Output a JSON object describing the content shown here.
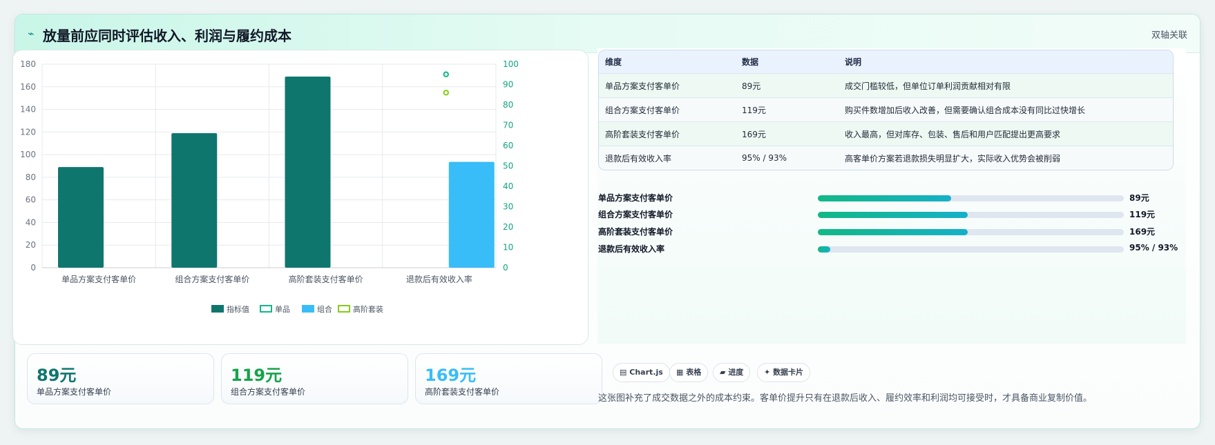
{
  "header": {
    "icon": "pulse-icon",
    "title": "放量前应同时评估收入、利润与履约成本",
    "badge": "双轴关联"
  },
  "chart_data": {
    "type": "bar",
    "categories": [
      "单品方案支付客单价",
      "组合方案支付客单价",
      "高阶套装支付客单价",
      "退款后有效收入率"
    ],
    "series": [
      {
        "name": "指标值",
        "type": "bar",
        "axis": "left",
        "values": [
          89,
          119,
          169,
          null
        ],
        "color": "#0f766e"
      },
      {
        "name": "单品",
        "type": "point",
        "axis": "right",
        "values": [
          null,
          null,
          null,
          95
        ],
        "color": "#12b886"
      },
      {
        "name": "组合",
        "type": "bar",
        "axis": "right",
        "values": [
          null,
          null,
          null,
          52
        ],
        "color": "#38bdf8"
      },
      {
        "name": "高阶套装",
        "type": "point",
        "axis": "right",
        "values": [
          null,
          null,
          null,
          86
        ],
        "color": "#84cc16"
      }
    ],
    "y_left": {
      "ylim": [
        0,
        180
      ],
      "ticks": [
        "0",
        "20",
        "40",
        "60",
        "80",
        "100",
        "120",
        "140",
        "160",
        "180"
      ]
    },
    "y_right": {
      "ylim": [
        0,
        100
      ],
      "ticks": [
        "0",
        "10",
        "20",
        "30",
        "40",
        "50",
        "60",
        "70",
        "80",
        "90",
        "100"
      ]
    },
    "grid": true,
    "legend": "bottom"
  },
  "table": {
    "headers": [
      "维度",
      "数据",
      "说明"
    ],
    "rows": [
      [
        "单品方案支付客单价",
        "89元",
        "成交门槛较低，但单位订单利润贡献相对有限"
      ],
      [
        "组合方案支付客单价",
        "119元",
        "购买件数增加后收入改善，但需要确认组合成本没有同比过快增长"
      ],
      [
        "高阶套装支付客单价",
        "169元",
        "收入最高，但对库存、包装、售后和用户匹配提出更高要求"
      ],
      [
        "退款后有效收入率",
        "95% / 93%",
        "高客单价方案若退款损失明显扩大，实际收入优势会被削弱"
      ]
    ]
  },
  "progress": [
    {
      "label": "单品方案支付客单价",
      "value": "89元",
      "fraction": 0.435
    },
    {
      "label": "组合方案支付客单价",
      "value": "119元",
      "fraction": 0.49
    },
    {
      "label": "高阶套装支付客单价",
      "value": "169元",
      "fraction": 0.49
    },
    {
      "label": "退款后有效收入率",
      "value": "95% / 93%",
      "fraction": 0.04
    }
  ],
  "stats": [
    {
      "value": "89元",
      "caption": "单品方案支付客单价",
      "color": "#0f766e"
    },
    {
      "value": "119元",
      "caption": "组合方案支付客单价",
      "color": "#16a34a"
    },
    {
      "value": "169元",
      "caption": "高阶套装支付客单价",
      "color": "#38bdf8"
    }
  ],
  "chips": [
    {
      "icon": "chart-icon",
      "glyph": "▤",
      "label": "Chart.js"
    },
    {
      "icon": "table-icon",
      "glyph": "▦",
      "label": "表格"
    },
    {
      "icon": "progress-icon",
      "glyph": "▰",
      "label": "进度"
    },
    {
      "icon": "sparkle-icon",
      "glyph": "✦",
      "label": "数据卡片"
    }
  ],
  "note": "这张图补充了成交数据之外的成本约束。客单价提升只有在退款后收入、履约效率和利润均可接受时，才具备商业复制价值。"
}
